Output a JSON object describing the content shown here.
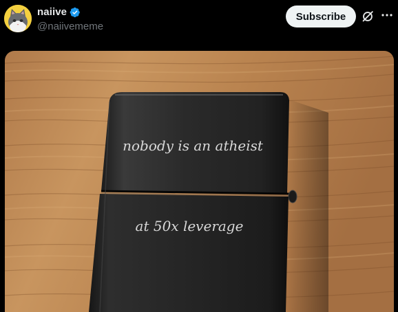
{
  "post": {
    "author": {
      "display_name": "naiive",
      "handle": "@naiivememe",
      "verified": true,
      "avatar_icon": "cat-avatar-icon"
    },
    "actions": {
      "subscribe_label": "Subscribe",
      "grok_icon": "grok-icon",
      "more_icon": "more-icon"
    },
    "media": {
      "engraving_line_1": "nobody is an atheist",
      "engraving_line_2": "at 50x leverage"
    }
  },
  "colors": {
    "background": "#000000",
    "text_primary": "#e7e9ea",
    "text_secondary": "#71767b",
    "verified_blue": "#1d9bf0",
    "subscribe_bg": "#eff3f4",
    "subscribe_text": "#0f1419",
    "avatar_yellow": "#f4d03f"
  }
}
